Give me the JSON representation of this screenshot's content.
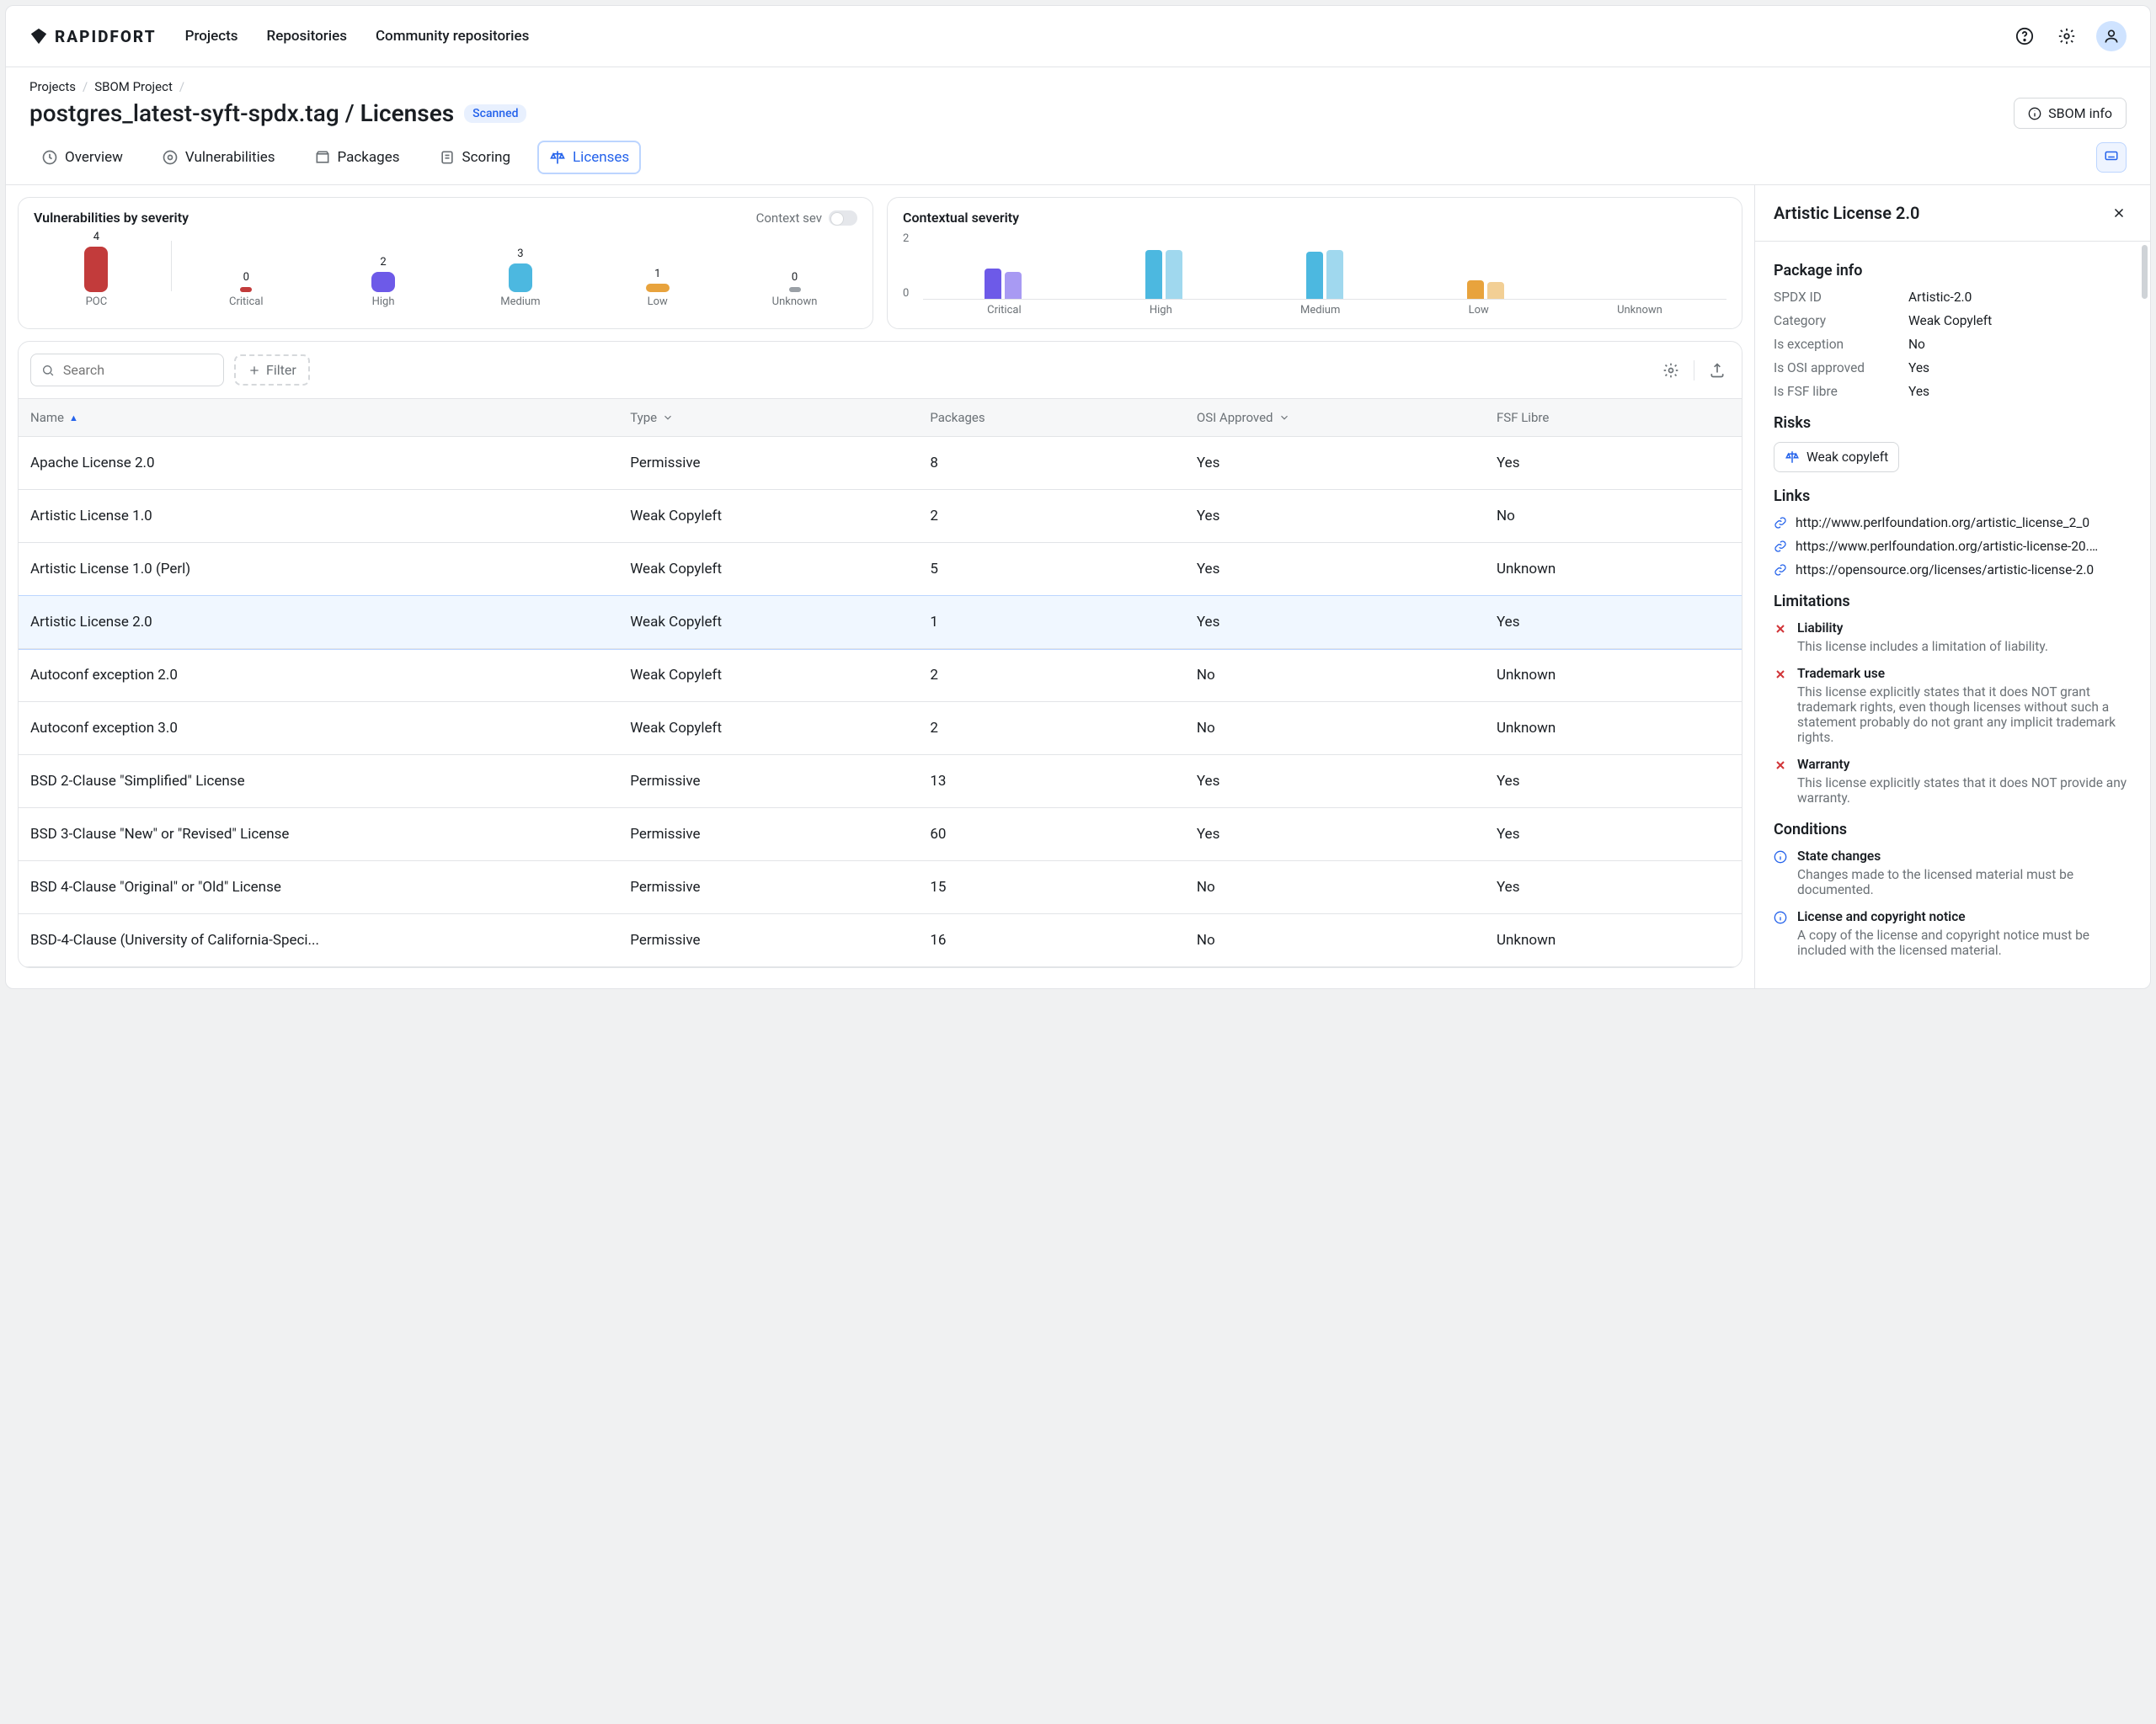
{
  "brand": "RAPIDFORT",
  "topnav": [
    "Projects",
    "Repositories",
    "Community repositories"
  ],
  "breadcrumb": [
    "Projects",
    "SBOM Project"
  ],
  "page_title_left": "postgres_latest-syft-spdx.tag",
  "page_title_right": "Licenses",
  "badge": "Scanned",
  "sbom_button": "SBOM info",
  "tabs": [
    "Overview",
    "Vulnerabilities",
    "Packages",
    "Scoring",
    "Licenses"
  ],
  "active_tab": "Licenses",
  "card1": {
    "title": "Vulnerabilities by severity",
    "toggle_label": "Context sev"
  },
  "card2": {
    "title": "Contextual severity"
  },
  "sev_data": [
    {
      "label": "POC",
      "value": 4,
      "h": 54,
      "color": "#c23b3b"
    },
    {
      "label": "Critical",
      "value": 0,
      "h": 0,
      "color": "#c23b3b"
    },
    {
      "label": "High",
      "value": 2,
      "h": 24,
      "color": "#6d5ae8"
    },
    {
      "label": "Medium",
      "value": 3,
      "h": 34,
      "color": "#4cb8e0"
    },
    {
      "label": "Low",
      "value": 1,
      "h": 10,
      "color": "#e8a33d"
    },
    {
      "label": "Unknown",
      "value": 0,
      "h": 0,
      "color": "#9aa0a6"
    }
  ],
  "ctx_axis": [
    "2",
    "0"
  ],
  "ctx_labels": [
    "Critical",
    "High",
    "Medium",
    "Low",
    "Unknown"
  ],
  "ctx_bars": [
    [
      {
        "h": 36,
        "c": "#6d5ae8"
      },
      {
        "h": 32,
        "c": "#a89af3"
      }
    ],
    [
      {
        "h": 58,
        "c": "#4cb8e0"
      },
      {
        "h": 58,
        "c": "#a0d8ee"
      }
    ],
    [
      {
        "h": 56,
        "c": "#4cb8e0"
      },
      {
        "h": 58,
        "c": "#a0d8ee"
      }
    ],
    [
      {
        "h": 22,
        "c": "#e8a33d"
      },
      {
        "h": 20,
        "c": "#f2cf95"
      }
    ],
    [
      {
        "h": 0,
        "c": "#9aa0a6"
      },
      {
        "h": 0,
        "c": "#c9cdd1"
      }
    ]
  ],
  "table": {
    "search_placeholder": "Search",
    "filter_label": "Filter",
    "columns": [
      "Name",
      "Type",
      "Packages",
      "OSI Approved",
      "FSF Libre"
    ],
    "rows": [
      {
        "name": "Apache License 2.0",
        "type": "Permissive",
        "packages": "8",
        "osi": "Yes",
        "fsf": "Yes"
      },
      {
        "name": "Artistic License 1.0",
        "type": "Weak Copyleft",
        "packages": "2",
        "osi": "Yes",
        "fsf": "No"
      },
      {
        "name": "Artistic License 1.0 (Perl)",
        "type": "Weak Copyleft",
        "packages": "5",
        "osi": "Yes",
        "fsf": "Unknown"
      },
      {
        "name": "Artistic License 2.0",
        "type": "Weak Copyleft",
        "packages": "1",
        "osi": "Yes",
        "fsf": "Yes",
        "selected": true
      },
      {
        "name": "Autoconf exception 2.0",
        "type": "Weak Copyleft",
        "packages": "2",
        "osi": "No",
        "fsf": "Unknown"
      },
      {
        "name": "Autoconf exception 3.0",
        "type": "Weak Copyleft",
        "packages": "2",
        "osi": "No",
        "fsf": "Unknown"
      },
      {
        "name": "BSD 2-Clause \"Simplified\" License",
        "type": "Permissive",
        "packages": "13",
        "osi": "Yes",
        "fsf": "Yes"
      },
      {
        "name": "BSD 3-Clause \"New\" or \"Revised\" License",
        "type": "Permissive",
        "packages": "60",
        "osi": "Yes",
        "fsf": "Yes"
      },
      {
        "name": "BSD 4-Clause \"Original\" or \"Old\" License",
        "type": "Permissive",
        "packages": "15",
        "osi": "No",
        "fsf": "Yes"
      },
      {
        "name": "BSD-4-Clause (University of California-Speci...",
        "type": "Permissive",
        "packages": "16",
        "osi": "No",
        "fsf": "Unknown"
      }
    ]
  },
  "panel": {
    "title": "Artistic License 2.0",
    "section_info": "Package info",
    "kv": [
      {
        "k": "SPDX ID",
        "v": "Artistic-2.0"
      },
      {
        "k": "Category",
        "v": "Weak Copyleft"
      },
      {
        "k": "Is exception",
        "v": "No"
      },
      {
        "k": "Is OSI approved",
        "v": "Yes"
      },
      {
        "k": "Is FSF libre",
        "v": "Yes"
      }
    ],
    "section_risks": "Risks",
    "risk_chip": "Weak copyleft",
    "section_links": "Links",
    "links": [
      "http://www.perlfoundation.org/artistic_license_2_0",
      "https://www.perlfoundation.org/artistic-license-20.ht...",
      "https://opensource.org/licenses/artistic-license-2.0"
    ],
    "section_limitations": "Limitations",
    "limitations": [
      {
        "t": "Liability",
        "d": "This license includes a limitation of liability."
      },
      {
        "t": "Trademark use",
        "d": "This license explicitly states that it does NOT grant trademark rights, even though licenses without such a statement probably do not grant any implicit trademark rights."
      },
      {
        "t": "Warranty",
        "d": "This license explicitly states that it does NOT provide any warranty."
      }
    ],
    "section_conditions": "Conditions",
    "conditions": [
      {
        "t": "State changes",
        "d": "Changes made to the licensed material must be documented."
      },
      {
        "t": "License and copyright notice",
        "d": "A copy of the license and copyright notice must be included with the licensed material."
      }
    ]
  }
}
